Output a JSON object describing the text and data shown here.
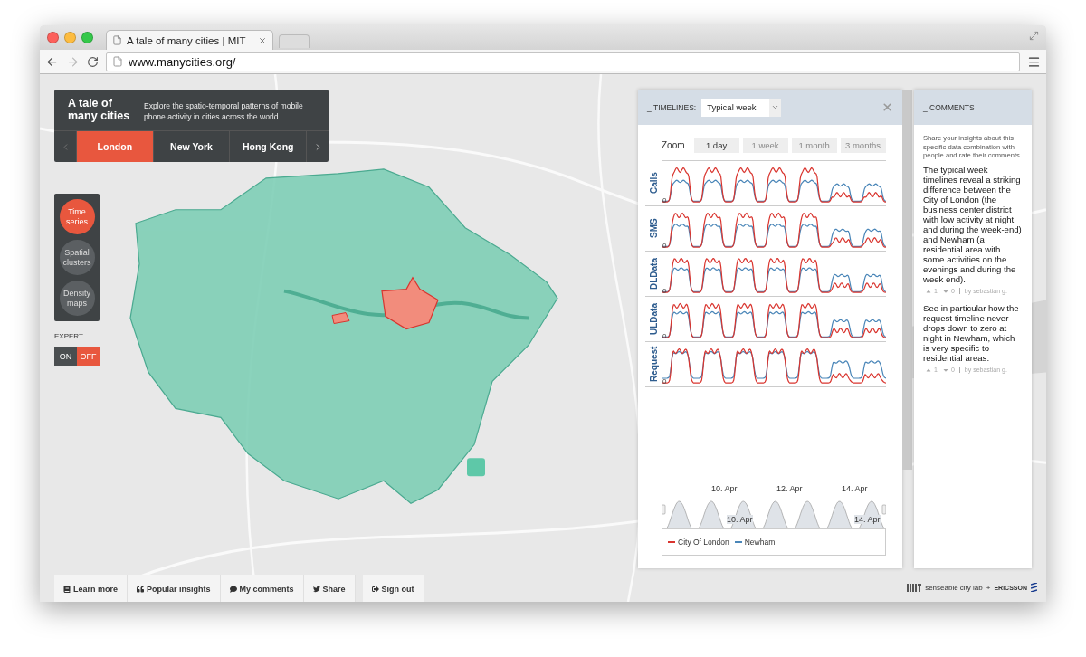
{
  "browser": {
    "tab_title": "A tale of many cities | MIT",
    "url": "www.manycities.org/"
  },
  "intro": {
    "title": "A tale of many cities",
    "description": "Explore the spatio-temporal patterns of mobile phone activity in cities across the world.",
    "cities": [
      {
        "label": "London",
        "selected": true
      },
      {
        "label": "New York",
        "selected": false
      },
      {
        "label": "Hong Kong",
        "selected": false
      }
    ]
  },
  "modes": [
    {
      "label": "Time series",
      "selected": true
    },
    {
      "label": "Spatial clusters",
      "selected": false
    },
    {
      "label": "Density maps",
      "selected": false
    }
  ],
  "expert": {
    "label": "EXPERT",
    "options": [
      {
        "label": "ON",
        "selected": false
      },
      {
        "label": "OFF",
        "selected": true
      }
    ]
  },
  "timelines": {
    "label": "_ TIMELINES:",
    "dropdown": "Typical week",
    "zoom_label": "Zoom",
    "zoom_options": [
      {
        "label": "1 day",
        "disabled": false
      },
      {
        "label": "1 week",
        "disabled": true
      },
      {
        "label": "1 month",
        "disabled": true
      },
      {
        "label": "3 months",
        "disabled": true
      }
    ],
    "charts": [
      {
        "name": "Calls",
        "zero": "0"
      },
      {
        "name": "SMS",
        "zero": "0"
      },
      {
        "name": "DLData",
        "zero": "0"
      },
      {
        "name": "ULData",
        "zero": "0"
      },
      {
        "name": "Request",
        "zero": "0"
      }
    ],
    "navigator": {
      "top_ticks": [
        "10. Apr",
        "12. Apr",
        "14. Apr"
      ],
      "bottom_ticks": [
        "10. Apr",
        "14. Apr"
      ]
    },
    "legend": [
      {
        "label": "City Of London",
        "color": "#d9352f"
      },
      {
        "label": "Newham",
        "color": "#4a86b8"
      }
    ]
  },
  "comments": {
    "title": "_ COMMENTS",
    "intro": "Share your insights about this specific data combination with people and rate their comments.",
    "items": [
      {
        "text": "The typical week timelines reveal a striking difference between the City of London (the business center district with low activity at night and during the week-end) and Newham (a residential area with some activities on the evenings and during the week end).",
        "up": "1",
        "down": "0",
        "author": "by sebastian g."
      },
      {
        "text": "See in particular how the request timeline never drops down to zero at night in Newham, which is very specific to residential areas.",
        "up": "1",
        "down": "0",
        "author": "by sebastian g."
      }
    ]
  },
  "footer": {
    "buttons": [
      {
        "kind": "book",
        "label": "Learn more"
      },
      {
        "kind": "quote",
        "label": "Popular insights"
      },
      {
        "kind": "comment",
        "label": "My comments"
      },
      {
        "kind": "twitter",
        "label": "Share"
      }
    ],
    "signout": "Sign out"
  },
  "credit": {
    "lab": "senseable city lab",
    "plus": "+",
    "partner": "ERICSSON"
  }
}
